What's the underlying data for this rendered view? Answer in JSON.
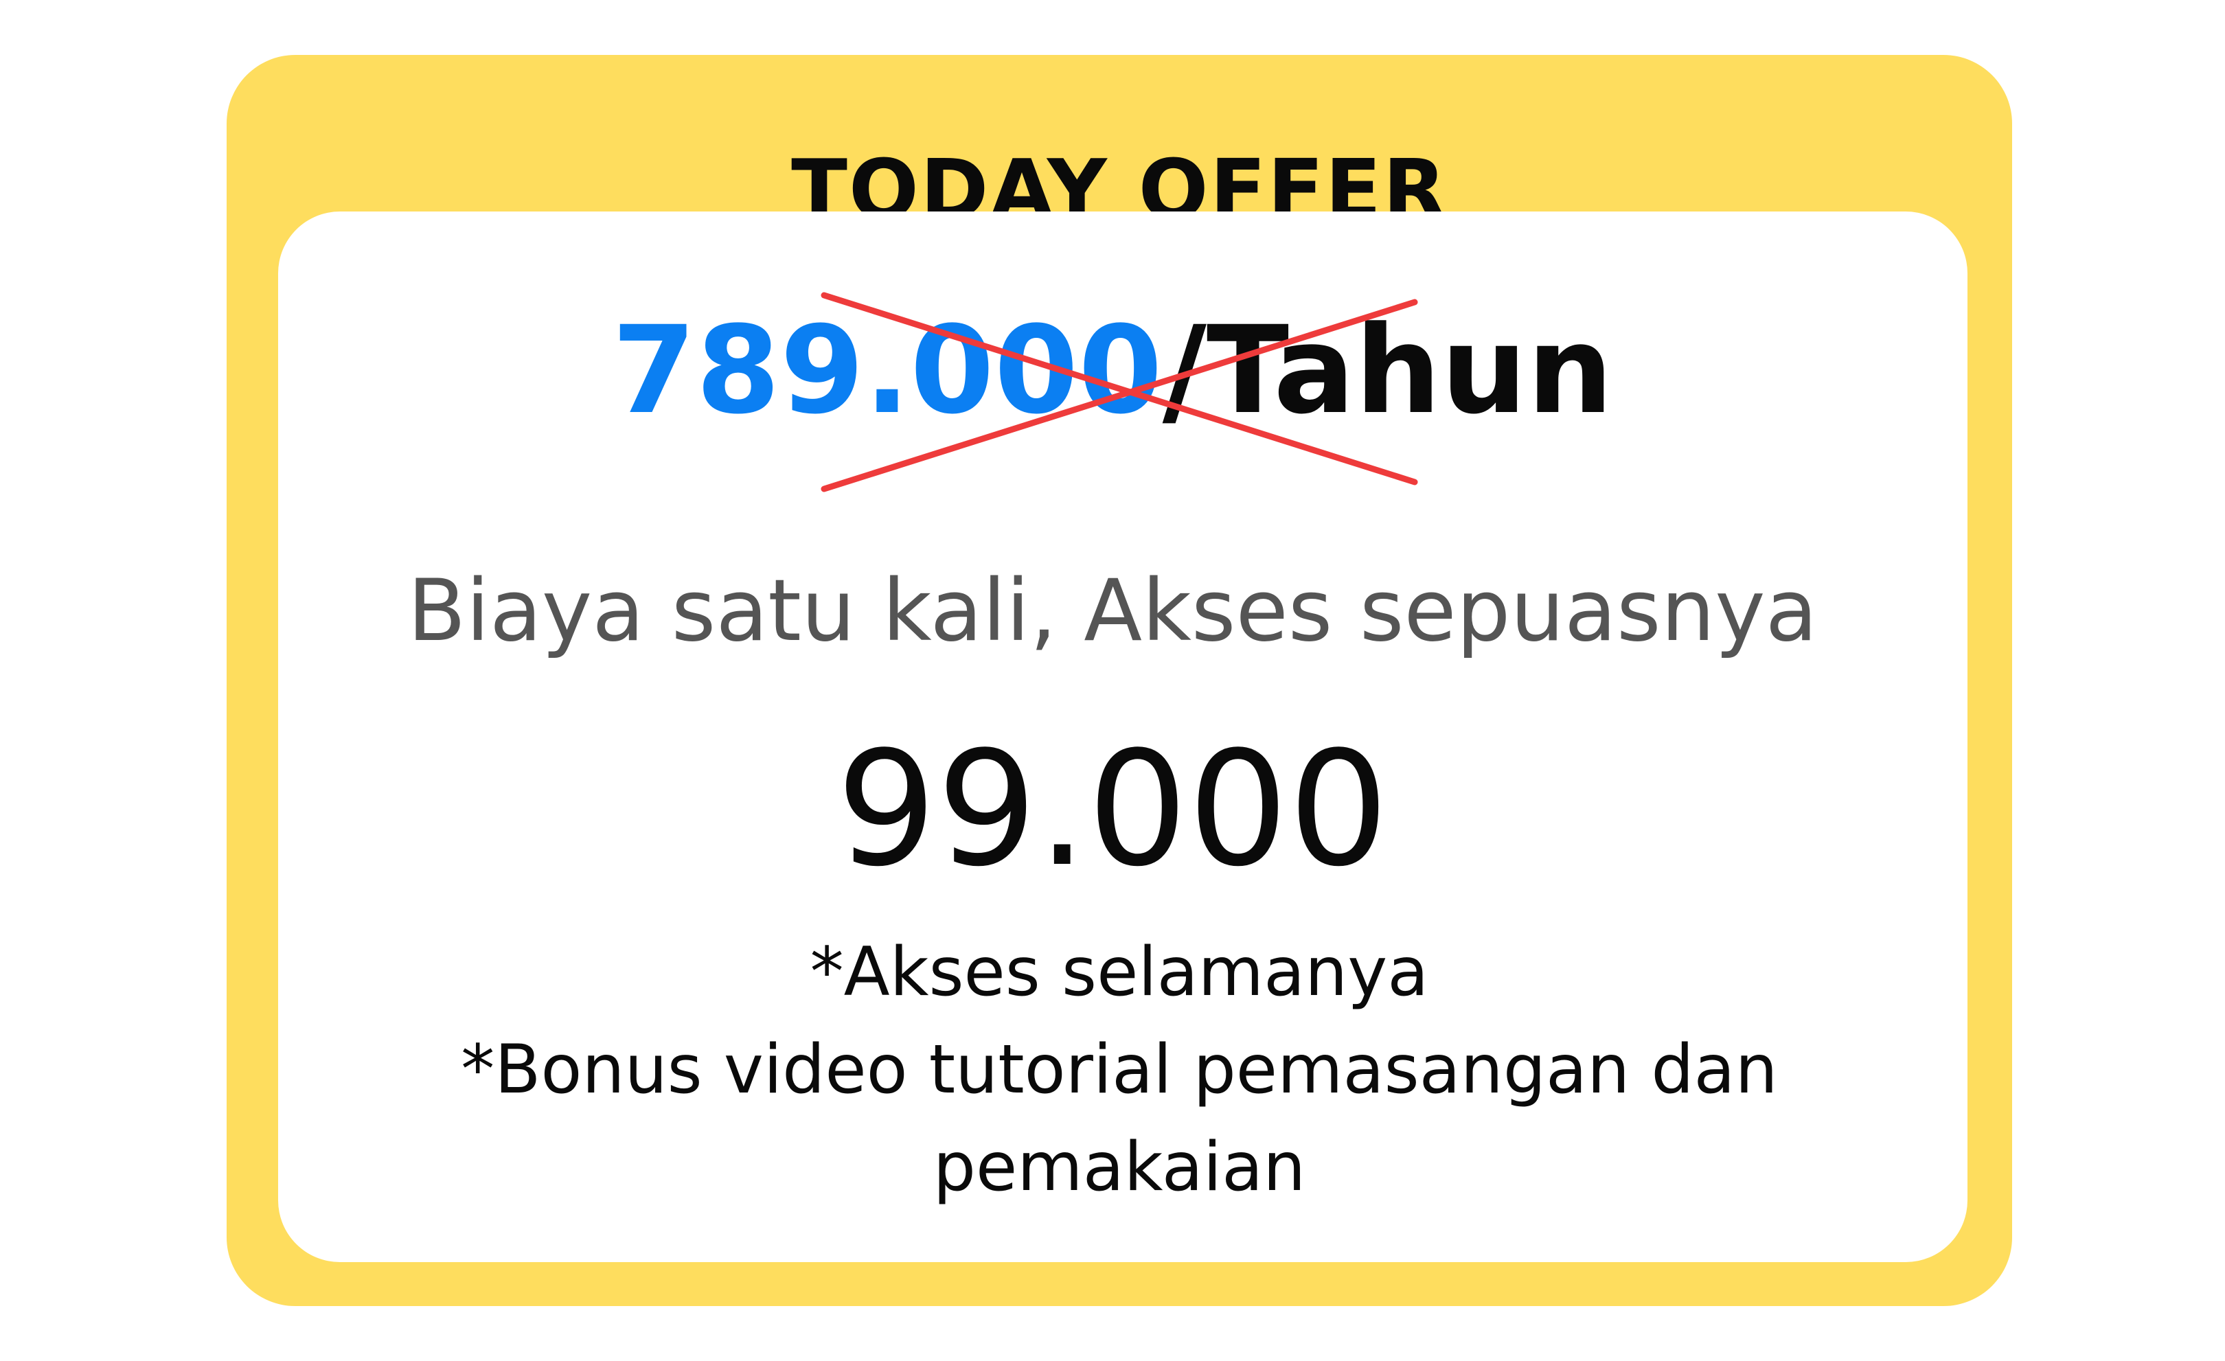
{
  "offer": {
    "title": "TODAY OFFER",
    "old_price_amount": "789.000",
    "old_price_suffix": "/Tahun",
    "tagline": "Biaya satu kali, Akses sepuasnya",
    "new_price": "99.000",
    "notes": [
      "*Akses selamanya",
      "*Bonus video tutorial pemasangan dan pemakaian"
    ]
  },
  "colors": {
    "card_background": "#FEDD5E",
    "inner_background": "#FFFFFF",
    "old_price_amount": "#0B7FF2",
    "strike_cross": "#EE3B3B",
    "tagline": "#555555",
    "text": "#0A0A0A"
  }
}
